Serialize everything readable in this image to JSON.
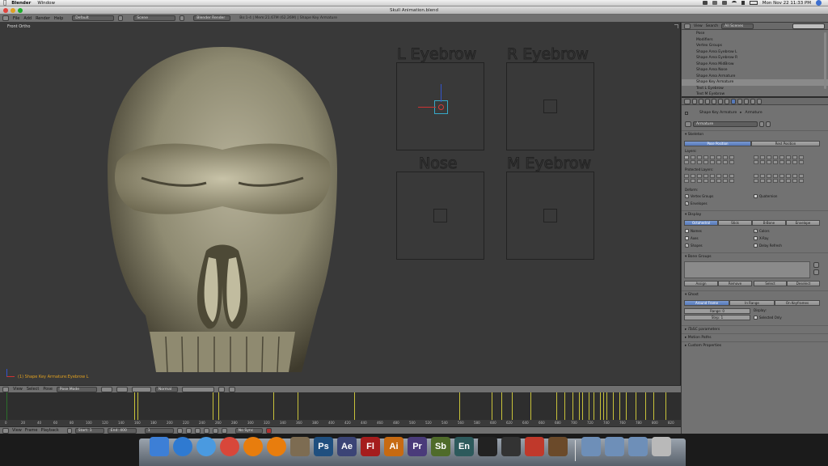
{
  "menubar": {
    "apple": "",
    "app": "Blender",
    "menus": [
      "Window"
    ],
    "clock": "Mon Nov 22  11:33 PM"
  },
  "window": {
    "title": "Skull Animation.blend"
  },
  "info_header": {
    "menus": [
      "File",
      "Add",
      "Render",
      "Help"
    ],
    "layout": "Default",
    "scene": "Scene",
    "engine": "Blender Render",
    "stats": "Bo:1-4 | Mem:21.67M (62.26M) | Shape Key Armature"
  },
  "viewport": {
    "view_label": "Front Ortho",
    "status_text": "(1) Shape Key Armature:Eyebrow L",
    "controls": [
      {
        "label": "L Eyebrow"
      },
      {
        "label": "R Eyebrow"
      },
      {
        "label": "Nose"
      },
      {
        "label": "M Eyebrow"
      }
    ]
  },
  "outliner": {
    "header": {
      "view": "View",
      "search": "Search",
      "scope": "All Scenes"
    },
    "items": [
      "Pose",
      "Modifiers",
      "Vertex Groups",
      "Shape Area Eyebrow L",
      "Shape Area Eyebrow R",
      "Shape Area MidBrow",
      "Shape Area Nose",
      "Shape Area Armature",
      "Shape Key Armature",
      "Text L Eyebrow",
      "Text M Eyebrow"
    ]
  },
  "properties": {
    "breadcrumb": [
      "Shape Key Armature",
      "Armature"
    ],
    "datablock": "Armature",
    "skeleton": {
      "title": "Skeleton",
      "pose_position": "Pose Position",
      "rest_position": "Rest Position",
      "layers_label": "Layers:",
      "protected_label": "Protected Layers:",
      "deform_label": "Deform:",
      "vertex_groups": "Vertex Groups",
      "envelopes": "Envelopes",
      "quaternion": "Quaternion"
    },
    "display": {
      "title": "Display",
      "modes": [
        "Octahedral",
        "Stick",
        "B-Bone",
        "Envelope"
      ],
      "names": "Names",
      "axes": "Axes",
      "shapes": "Shapes",
      "colors": "Colors",
      "xray": "X-Ray",
      "delay": "Delay Refresh"
    },
    "bone_groups": {
      "title": "Bone Groups",
      "buttons": [
        "Assign",
        "Remove",
        "Select",
        "Deselect"
      ]
    },
    "ghost": {
      "title": "Ghost",
      "modes": [
        "Around Frame",
        "In Range",
        "On Keyframes"
      ],
      "range": "Range: 0",
      "step": "Step: 1",
      "display_label": "Display:",
      "selected_only": "Selected Only"
    },
    "collapsed": [
      "iTaSC parameters",
      "Motion Paths",
      "Custom Properties"
    ]
  },
  "timeline_header": {
    "menus": [
      "View",
      "Select",
      "Pose"
    ],
    "mode": "Pose Mode",
    "pivot": "Normal"
  },
  "timeline": {
    "ticks": [
      "0",
      "20",
      "40",
      "60",
      "80",
      "100",
      "120",
      "140",
      "160",
      "180",
      "200",
      "220",
      "240",
      "260",
      "280",
      "300",
      "320",
      "340",
      "360",
      "380",
      "400",
      "420",
      "440",
      "460",
      "480",
      "500",
      "520",
      "540",
      "560",
      "580",
      "600",
      "620",
      "640",
      "660",
      "680",
      "700",
      "720",
      "740",
      "760",
      "780",
      "800",
      "820"
    ],
    "keyframes": [
      158,
      162,
      255,
      262,
      330,
      360,
      430,
      560,
      600,
      612,
      625,
      648,
      680,
      690,
      700,
      708,
      712,
      720,
      726,
      734,
      738,
      742,
      750,
      758,
      766,
      778,
      790,
      800,
      815
    ]
  },
  "timeline_footer": {
    "menus": [
      "View",
      "Frame",
      "Playback"
    ],
    "start": "Start: 1",
    "end": "End: 400",
    "current": "1",
    "sync": "No Sync"
  },
  "dock": {
    "items": [
      {
        "name": "finder",
        "label": "",
        "color": "#3d7fd6"
      },
      {
        "name": "itunes",
        "label": "",
        "color": "#2f7ad1"
      },
      {
        "name": "safari",
        "label": "",
        "color": "#4a9ae0"
      },
      {
        "name": "chrome",
        "label": "",
        "color": "#d8473a"
      },
      {
        "name": "blender-1",
        "label": "",
        "color": "#e87d0d"
      },
      {
        "name": "blender-2",
        "label": "",
        "color": "#e87d0d"
      },
      {
        "name": "gimp",
        "label": "",
        "color": "#7d6c52"
      },
      {
        "name": "photoshop",
        "label": "Ps",
        "color": "#1f4f7f"
      },
      {
        "name": "after-effects",
        "label": "Ae",
        "color": "#3b4476"
      },
      {
        "name": "flash",
        "label": "Fl",
        "color": "#a51d1d"
      },
      {
        "name": "illustrator",
        "label": "Ai",
        "color": "#c76a12"
      },
      {
        "name": "premiere",
        "label": "Pr",
        "color": "#4a3b7a"
      },
      {
        "name": "soundbooth",
        "label": "Sb",
        "color": "#4f6b2a"
      },
      {
        "name": "encore",
        "label": "En",
        "color": "#2d5a5c"
      },
      {
        "name": "final-cut",
        "label": "",
        "color": "#222222"
      },
      {
        "name": "motion",
        "label": "",
        "color": "#333333"
      },
      {
        "name": "sbp",
        "label": "",
        "color": "#c0392b"
      },
      {
        "name": "preview",
        "label": "",
        "color": "#6b4a2a"
      },
      {
        "name": "applications",
        "label": "",
        "color": "#6e8fb8"
      },
      {
        "name": "documents",
        "label": "",
        "color": "#6e8fb8"
      },
      {
        "name": "downloads",
        "label": "",
        "color": "#6e8fb8"
      },
      {
        "name": "trash",
        "label": "",
        "color": "#b9b9b9"
      }
    ]
  }
}
